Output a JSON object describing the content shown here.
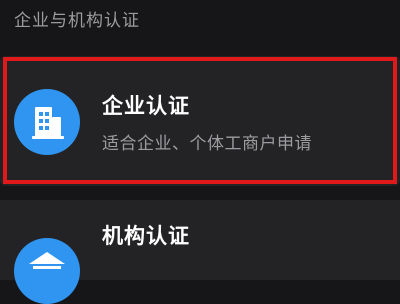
{
  "section": {
    "title": "企业与机构认证"
  },
  "items": [
    {
      "title": "企业认证",
      "description": "适合企业、个体工商户申请",
      "icon": "building-icon",
      "highlighted": true
    },
    {
      "title": "机构认证",
      "icon": "institution-icon",
      "highlighted": false
    }
  ],
  "colors": {
    "background": "#161618",
    "card": "#232326",
    "accent": "#2f95f0",
    "highlight": "#e01a1a",
    "secondary_text": "#9c9c9f"
  }
}
